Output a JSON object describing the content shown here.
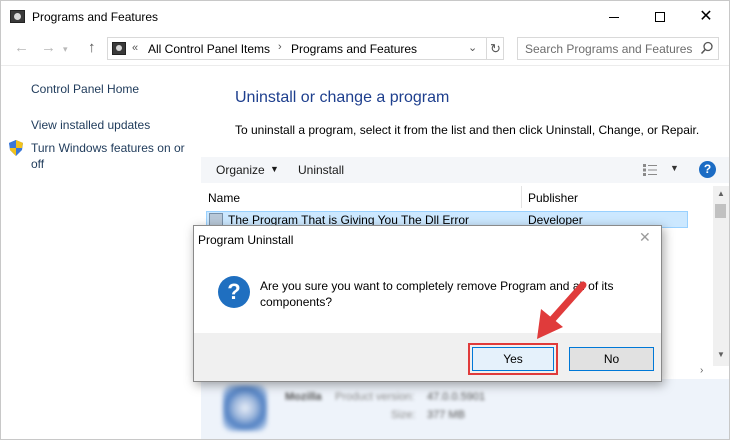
{
  "window": {
    "title": "Programs and Features"
  },
  "address": {
    "overflow": "«",
    "crumbs": [
      "All Control Panel Items",
      "Programs and Features"
    ]
  },
  "search": {
    "placeholder": "Search Programs and Features"
  },
  "sidebar": {
    "home": "Control Panel Home",
    "updates": "View installed updates",
    "features": "Turn Windows features on or off"
  },
  "main": {
    "heading": "Uninstall or change a program",
    "instruction": "To uninstall a program, select it from the list and then click Uninstall, Change, or Repair."
  },
  "toolbar": {
    "organize": "Organize",
    "uninstall": "Uninstall",
    "help": "?"
  },
  "list": {
    "columns": [
      "Name",
      "Publisher"
    ],
    "rows": [
      {
        "name": "The Program That is Giving You The Dll Error",
        "publisher": "Developer"
      }
    ]
  },
  "details": {
    "name": "Mozilla",
    "label1": "Product version:",
    "value1": "47.0.0.5901",
    "label2": "Size:",
    "value2": "377 MB"
  },
  "dialog": {
    "title": "Program Uninstall",
    "message": "Are you sure you want to completely remove Program and all of its components?",
    "yes": "Yes",
    "no": "No",
    "icon": "question-icon"
  },
  "colors": {
    "heading": "#1e3f8e",
    "selection": "#cce8ff",
    "annotation": "#e03b3b",
    "help": "#1c6cc4"
  }
}
